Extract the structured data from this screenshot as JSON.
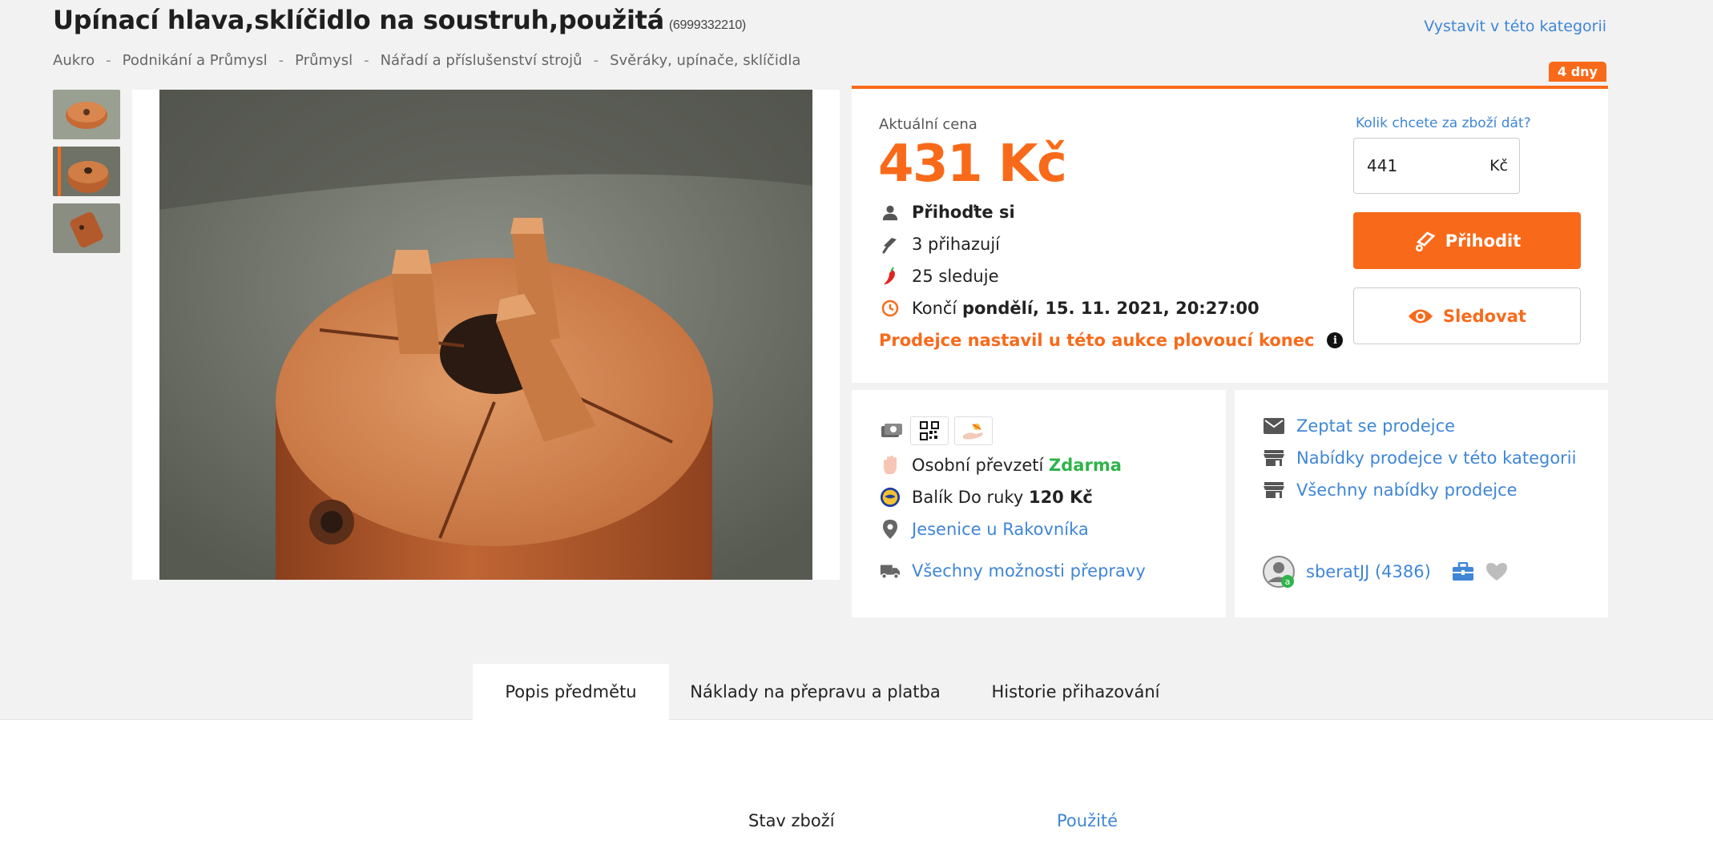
{
  "item": {
    "title": "Upínací hlava,sklíčidlo na soustruh,použitá",
    "id": "(6999332210)"
  },
  "header": {
    "list_in_category": "Vystavit v této kategorii"
  },
  "breadcrumb": [
    "Aukro",
    "Podnikání a Průmysl",
    "Průmysl",
    "Nářadí a příslušenství strojů",
    "Svěráky, upínače, sklíčidla"
  ],
  "breadcrumb_sep": "-",
  "price_panel": {
    "days_left": "4 dny",
    "price_label": "Aktuální cena",
    "price": "431 Kč",
    "bid_cta": "Přihoďte si",
    "bidders": "3 přihazují",
    "watchers": "25 sleduje",
    "ends_prefix": "Končí",
    "ends_value": "pondělí, 15. 11. 2021, 20:27:00",
    "floating_end": "Prodejce nastavil u této aukce plovoucí konec",
    "bid_question": "Kolik chcete za zboží dát?",
    "bid_value": "441",
    "bid_currency": "Kč",
    "bid_button": "Přihodit",
    "watch_button": "Sledovat"
  },
  "shipping": {
    "pickup_label": "Osobní převzetí",
    "pickup_price": "Zdarma",
    "parcel_label": "Balík Do ruky",
    "parcel_price": "120 Kč",
    "location": "Jesenice u Rakovníka",
    "all_options": "Všechny možnosti přepravy"
  },
  "seller": {
    "ask": "Zeptat se prodejce",
    "offers_in_category": "Nabídky prodejce v této kategorii",
    "all_offers": "Všechny nabídky prodejce",
    "name": "sberatJJ (4386)"
  },
  "tabs": [
    "Popis předmětu",
    "Náklady na přepravu a platba",
    "Historie přihazování"
  ],
  "specs": {
    "label": "Stav zboží",
    "value": "Použité"
  },
  "colors": {
    "accent": "#f86a1a",
    "link": "#3f86d6",
    "free": "#2fb34a"
  }
}
